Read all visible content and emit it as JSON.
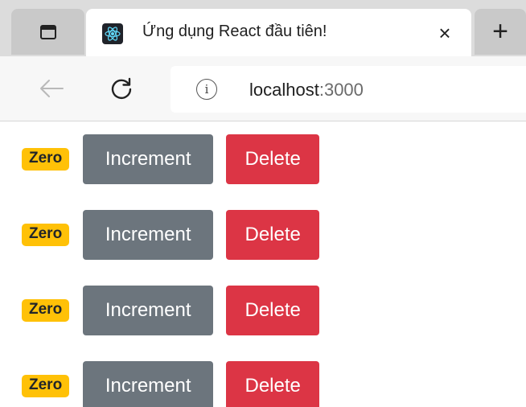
{
  "browser": {
    "tab": {
      "title": "Ứng dụng React đầu tiên!",
      "close_glyph": "×"
    },
    "new_tab_glyph": "+",
    "address_bar": {
      "host": "localhost",
      "port": ":3000"
    },
    "icons": {
      "tab_actions": "tab-actions-icon",
      "favicon": "react-logo-icon",
      "back": "arrow-left-icon",
      "refresh": "refresh-icon",
      "site_info": "info-icon"
    }
  },
  "counters": [
    {
      "badge": "Zero",
      "increment_label": "Increment",
      "delete_label": "Delete"
    },
    {
      "badge": "Zero",
      "increment_label": "Increment",
      "delete_label": "Delete"
    },
    {
      "badge": "Zero",
      "increment_label": "Increment",
      "delete_label": "Delete"
    },
    {
      "badge": "Zero",
      "increment_label": "Increment",
      "delete_label": "Delete"
    }
  ],
  "colors": {
    "badge_warning": "#ffc107",
    "button_secondary": "#6c757d",
    "button_danger": "#dc3545"
  }
}
